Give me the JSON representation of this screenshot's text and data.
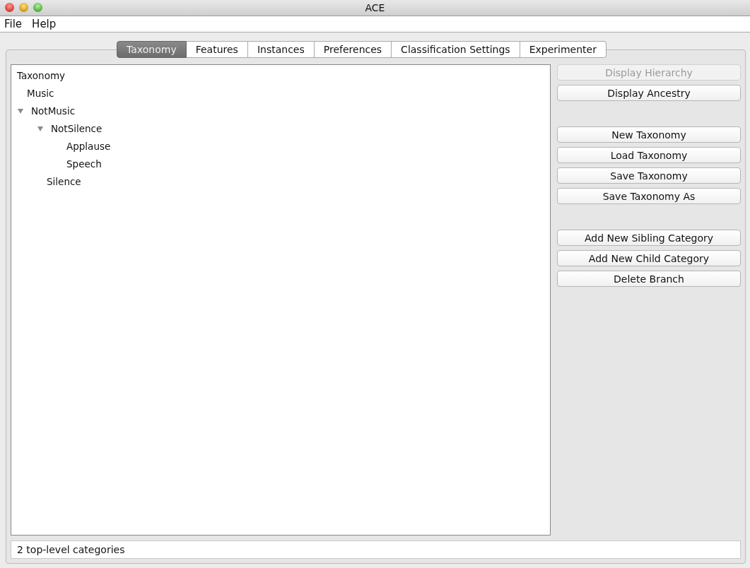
{
  "window": {
    "title": "ACE"
  },
  "menu": [
    "File",
    "Help"
  ],
  "tabs": [
    {
      "label": "Taxonomy",
      "selected": true
    },
    {
      "label": "Features",
      "selected": false
    },
    {
      "label": "Instances",
      "selected": false
    },
    {
      "label": "Preferences",
      "selected": false
    },
    {
      "label": "Classification Settings",
      "selected": false
    },
    {
      "label": "Experimenter",
      "selected": false
    }
  ],
  "tree": {
    "label": "Taxonomy",
    "children": [
      {
        "label": "Music"
      },
      {
        "label": "NotMusic",
        "expanded": true,
        "children": [
          {
            "label": "NotSilence",
            "expanded": true,
            "children": [
              {
                "label": "Applause"
              },
              {
                "label": "Speech"
              }
            ]
          },
          {
            "label": "Silence"
          }
        ]
      }
    ]
  },
  "button_groups": [
    [
      {
        "label": "Display Hierarchy",
        "disabled": true
      },
      {
        "label": "Display Ancestry",
        "disabled": false
      }
    ],
    [
      {
        "label": "New Taxonomy",
        "disabled": false
      },
      {
        "label": "Load Taxonomy",
        "disabled": false
      },
      {
        "label": "Save Taxonomy",
        "disabled": false
      },
      {
        "label": "Save Taxonomy As",
        "disabled": false
      }
    ],
    [
      {
        "label": "Add New Sibling Category",
        "disabled": false
      },
      {
        "label": "Add New Child Category",
        "disabled": false
      },
      {
        "label": "Delete Branch",
        "disabled": false
      }
    ]
  ],
  "status": "2 top-level categories"
}
